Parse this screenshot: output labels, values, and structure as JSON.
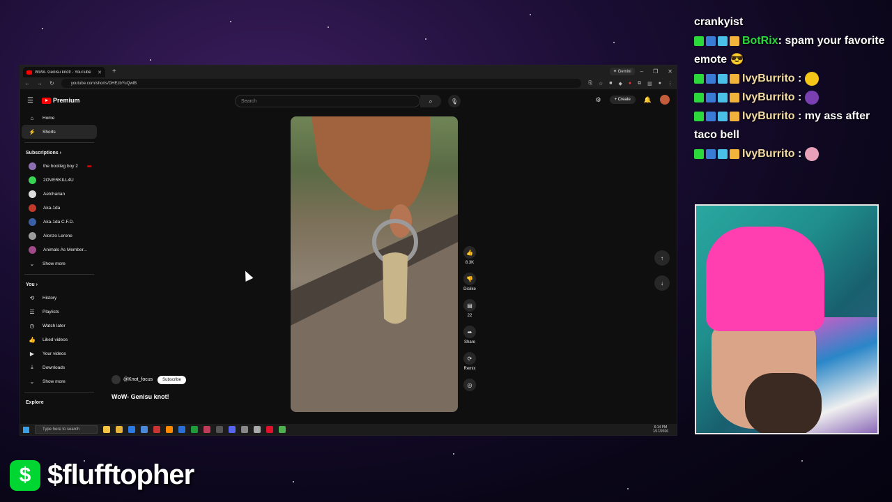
{
  "browser": {
    "tab_title": "WoW- Genisu knot! - YouTube",
    "gemini_label": "Gemini",
    "url": "youtube.com/shorts/DHEzbYuQwlB"
  },
  "youtube": {
    "logo_text": "Premium",
    "search_placeholder": "Search",
    "create_label": "Create",
    "sidebar": {
      "home": "Home",
      "shorts": "Shorts",
      "subscriptions_heading": "Subscriptions",
      "subscriptions": [
        {
          "name": "the bootleg boy 2",
          "color": "#8b6fb0"
        },
        {
          "name": "2OVERKILL4U",
          "color": "#39d353"
        },
        {
          "name": "Aetcharian",
          "color": "#dddddd"
        },
        {
          "name": "Aka-1da",
          "color": "#c0392b"
        },
        {
          "name": "Aka-1da C.F.D.",
          "color": "#3b5fa6"
        },
        {
          "name": "Alonzo Lerone",
          "color": "#9b9b9b"
        },
        {
          "name": "Animals As Member...",
          "color": "#a04a8a"
        }
      ],
      "show_more_1": "Show more",
      "you_heading": "You",
      "you_items": [
        "History",
        "Playlists",
        "Watch later",
        "Liked videos",
        "Your videos",
        "Downloads"
      ],
      "show_more_2": "Show more",
      "explore_heading": "Explore"
    },
    "short": {
      "channel": "@Knot_focus",
      "subscribe_label": "Subscribe",
      "title": "WoW- Genisu knot!",
      "likes": "8.3K",
      "dislike_label": "Dislike",
      "comments": "22",
      "share_label": "Share",
      "remix_label": "Remix"
    }
  },
  "taskbar": {
    "search_placeholder": "Type here to search",
    "time": "6:14 PM",
    "date": "1/17/2026"
  },
  "chat": {
    "partial_top": "crankyist",
    "messages": [
      {
        "user": "BotRix",
        "text": ": spam your favorite emote 😎",
        "color": "#2bd93b"
      },
      {
        "user": "IvyBurrito",
        "text": " : ",
        "color": "#f2d9a0"
      },
      {
        "user": "IvyBurrito",
        "text": " : ",
        "color": "#f2d9a0"
      },
      {
        "user": "IvyBurrito",
        "text": " : my ass after taco bell",
        "color": "#f2d9a0"
      },
      {
        "user": "IvyBurrito",
        "text": " : ",
        "color": "#f2d9a0"
      }
    ]
  },
  "cashtag": {
    "icon": "$",
    "text": "$flufftopher"
  }
}
